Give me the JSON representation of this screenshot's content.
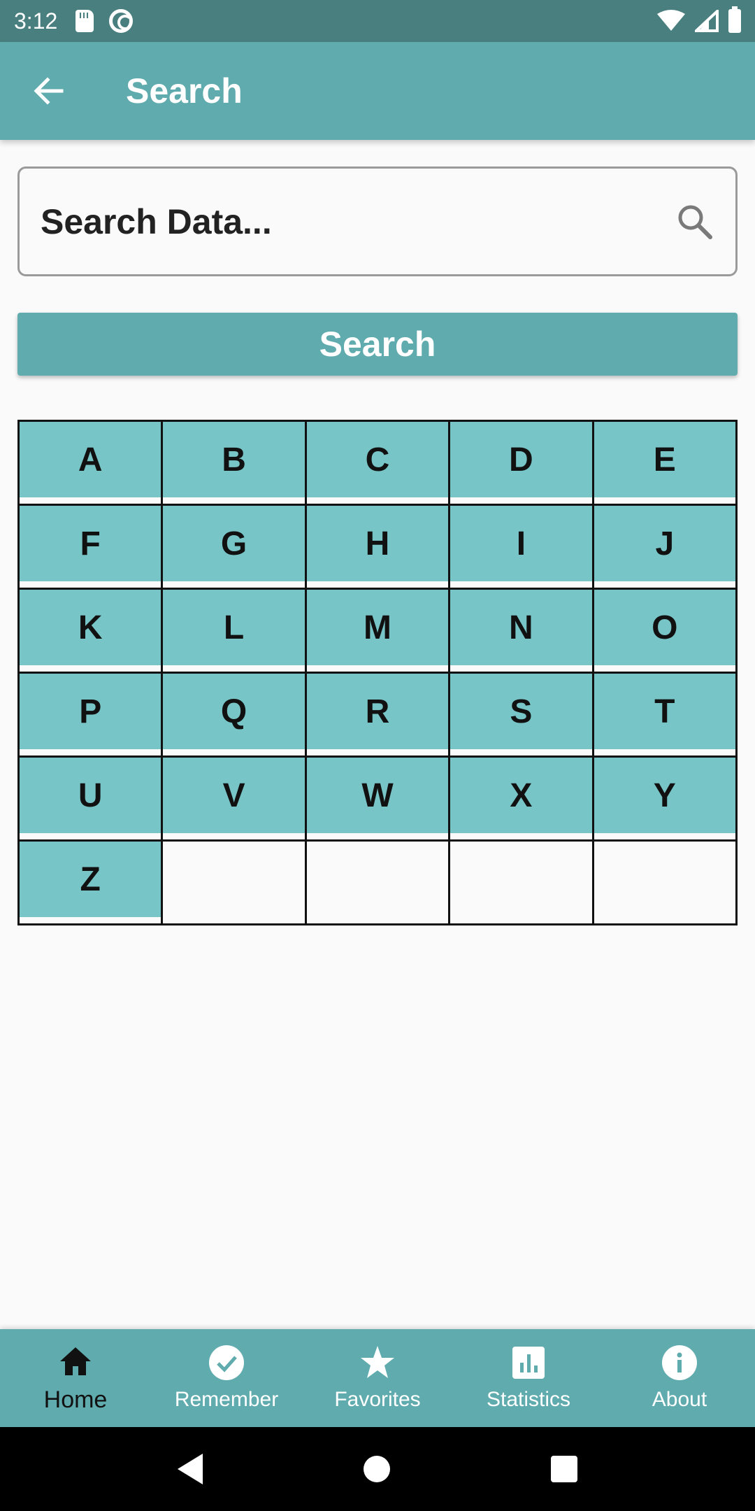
{
  "status_bar": {
    "time": "3:12"
  },
  "app_bar": {
    "title": "Search"
  },
  "search": {
    "placeholder": "Search Data...",
    "button_label": "Search"
  },
  "letters": [
    "A",
    "B",
    "C",
    "D",
    "E",
    "F",
    "G",
    "H",
    "I",
    "J",
    "K",
    "L",
    "M",
    "N",
    "O",
    "P",
    "Q",
    "R",
    "S",
    "T",
    "U",
    "V",
    "W",
    "X",
    "Y",
    "Z"
  ],
  "empty_cells": 4,
  "bottom_nav": {
    "items": [
      {
        "label": "Home",
        "icon": "home-icon",
        "active": true
      },
      {
        "label": "Remember",
        "icon": "check-circle-icon",
        "active": false
      },
      {
        "label": "Favorites",
        "icon": "star-icon",
        "active": false
      },
      {
        "label": "Statistics",
        "icon": "bar-chart-icon",
        "active": false
      },
      {
        "label": "About",
        "icon": "info-icon",
        "active": false
      }
    ]
  },
  "colors": {
    "primary": "#5fabae",
    "cell": "#78c5c7",
    "status_bar": "#4a7f80"
  }
}
